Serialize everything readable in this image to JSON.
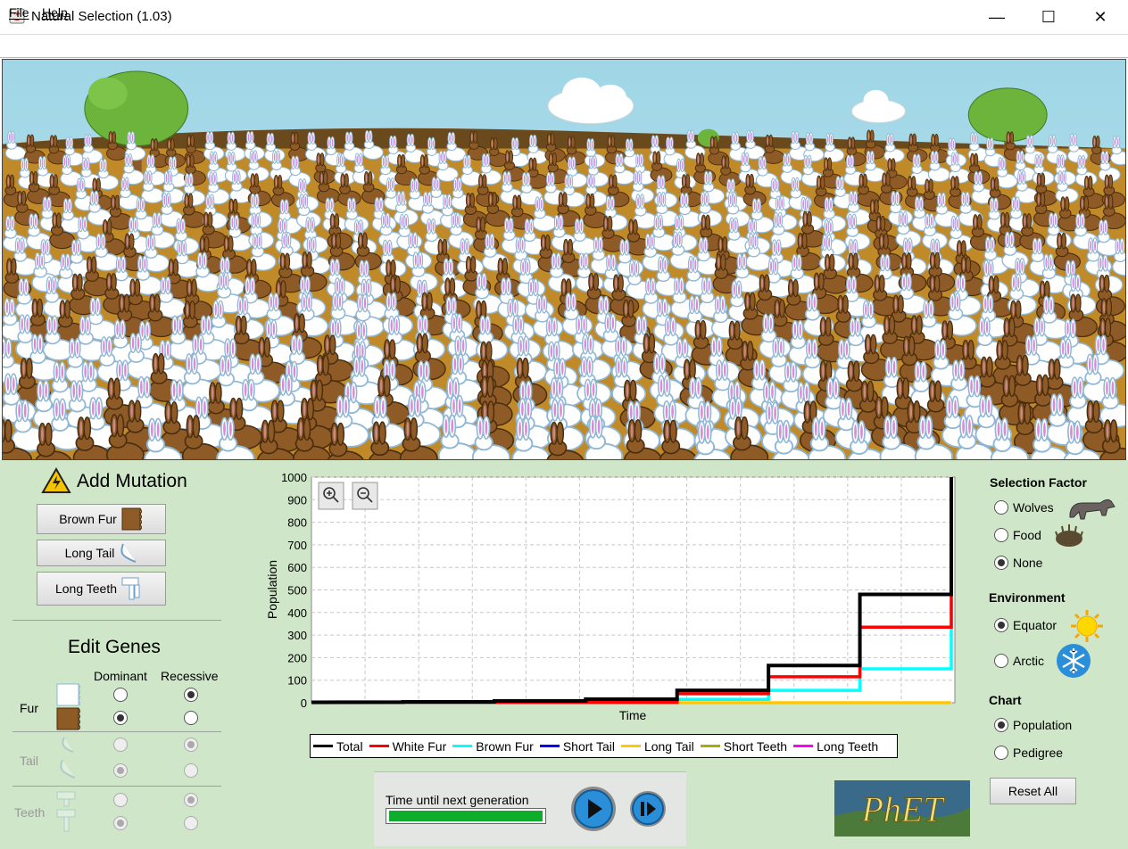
{
  "window": {
    "title": "Natural Selection (1.03)",
    "minimize": "—",
    "maximize": "☐",
    "close": "✕"
  },
  "menu": {
    "file": "File",
    "help": "Help"
  },
  "mutation": {
    "title": "Add Mutation",
    "buttons": [
      "Brown Fur",
      "Long Tail",
      "Long Teeth"
    ]
  },
  "genes": {
    "title": "Edit Genes",
    "columns": [
      "Dominant",
      "Recessive"
    ],
    "rows": [
      {
        "label": "Fur",
        "enabled": true,
        "dominant": "brown",
        "recessive": "white"
      },
      {
        "label": "Tail",
        "enabled": false
      },
      {
        "label": "Teeth",
        "enabled": false
      }
    ]
  },
  "chart_data": {
    "type": "line",
    "xlabel": "Time",
    "ylabel": "Population",
    "ylim": [
      0,
      1000
    ],
    "yticks": [
      0,
      100,
      200,
      300,
      400,
      500,
      600,
      700,
      800,
      900,
      1000
    ],
    "series": [
      {
        "name": "Total",
        "color": "#000000",
        "values": [
          [
            0,
            2
          ],
          [
            10,
            3
          ],
          [
            10,
            4
          ],
          [
            20,
            4
          ],
          [
            20,
            8
          ],
          [
            30,
            8
          ],
          [
            30,
            16
          ],
          [
            40,
            16
          ],
          [
            40,
            55
          ],
          [
            50,
            55
          ],
          [
            50,
            165
          ],
          [
            60,
            165
          ],
          [
            60,
            480
          ],
          [
            70,
            480
          ],
          [
            70,
            1000
          ]
        ]
      },
      {
        "name": "White Fur",
        "color": "#ff0000",
        "values": [
          [
            0,
            2
          ],
          [
            40,
            2
          ],
          [
            40,
            40
          ],
          [
            50,
            40
          ],
          [
            50,
            115
          ],
          [
            60,
            115
          ],
          [
            60,
            335
          ],
          [
            70,
            335
          ],
          [
            70,
            1000
          ]
        ]
      },
      {
        "name": "Brown Fur",
        "color": "#00ffff",
        "values": [
          [
            0,
            0
          ],
          [
            40,
            0
          ],
          [
            40,
            15
          ],
          [
            50,
            15
          ],
          [
            50,
            55
          ],
          [
            60,
            55
          ],
          [
            60,
            150
          ],
          [
            70,
            150
          ],
          [
            70,
            450
          ]
        ]
      },
      {
        "name": "Short Tail",
        "color": "#0000ff",
        "values": []
      },
      {
        "name": "Long Tail",
        "color": "#ffc800",
        "values": [
          [
            0,
            0
          ],
          [
            70,
            0
          ]
        ]
      },
      {
        "name": "Short Teeth",
        "color": "#aaaa00",
        "values": []
      },
      {
        "name": "Long Teeth",
        "color": "#ff00ff",
        "values": []
      }
    ]
  },
  "clock": {
    "label": "Time until next generation",
    "progress": 1.0
  },
  "selection": {
    "title": "Selection Factor",
    "options": [
      "Wolves",
      "Food",
      "None"
    ],
    "selected": "None"
  },
  "environment": {
    "title": "Environment",
    "options": [
      "Equator",
      "Arctic"
    ],
    "selected": "Equator"
  },
  "chart_choice": {
    "title": "Chart",
    "options": [
      "Population",
      "Pedigree"
    ],
    "selected": "Population"
  },
  "reset_label": "Reset All",
  "logo_text": "PhET",
  "colors": {
    "panel": "#cfe6c8",
    "sky": "#a8dbe8",
    "ground": "#c08a28",
    "brown_bunny": "#8e5b26",
    "white_bunny": "#ffffff"
  }
}
